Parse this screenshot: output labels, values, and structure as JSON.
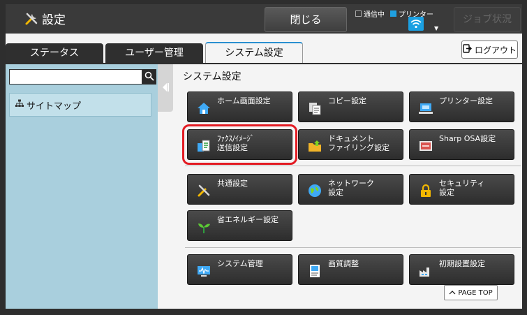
{
  "header": {
    "title": "設定",
    "close_label": "閉じる",
    "status": {
      "comm_label": "通信中",
      "printer_label": "プリンター",
      "comm_on": false,
      "printer_on": true
    },
    "job_status_label": "ジョブ状況"
  },
  "tabs": [
    {
      "label": "ステータス",
      "active": false
    },
    {
      "label": "ユーザー管理",
      "active": false
    },
    {
      "label": "システム設定",
      "active": true
    }
  ],
  "logout_label": "ログアウト",
  "sidebar": {
    "search": {
      "value": "",
      "placeholder": ""
    },
    "sitemap_label": "サイトマップ"
  },
  "main": {
    "title": "システム設定",
    "tiles": [
      {
        "label": "ホーム画面設定",
        "icon": "home-icon"
      },
      {
        "label": "コピー設定",
        "icon": "copy-icon"
      },
      {
        "label": "プリンター設定",
        "icon": "printer-icon"
      },
      {
        "label": "ﾌｧｸｽ/ｲﾒｰｼﾞ\n送信設定",
        "icon": "fax-image-send-icon",
        "highlighted": true
      },
      {
        "label": "ドキュメント\nファイリング設定",
        "icon": "folder-icon"
      },
      {
        "label": "Sharp OSA設定",
        "icon": "osa-icon"
      },
      {
        "label": "共通設定",
        "icon": "tools-icon"
      },
      {
        "label": "ネットワーク\n設定",
        "icon": "globe-icon"
      },
      {
        "label": "セキュリティ\n設定",
        "icon": "lock-icon"
      },
      {
        "label": "省エネルギー設定",
        "icon": "sprout-icon"
      },
      {
        "label": "システム管理",
        "icon": "monitor-icon"
      },
      {
        "label": "画質調整",
        "icon": "image-quality-icon"
      },
      {
        "label": "初期設置設定",
        "icon": "factory-icon"
      }
    ],
    "page_top_label": "PAGE TOP"
  },
  "colors": {
    "accent_blue": "#1ba0e2",
    "highlight_red": "#e31b23",
    "sidebar_bg": "#a9cfdd"
  }
}
